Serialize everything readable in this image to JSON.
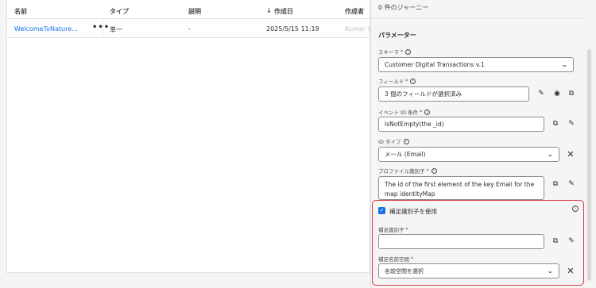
{
  "table": {
    "headers": {
      "name": "名前",
      "type": "タイプ",
      "description": "説明",
      "created": "作成日",
      "created_sort_icon": "arrow-down-icon",
      "creator": "作成者"
    },
    "rows": [
      {
        "name": "WelcomeToNature_1_...",
        "more": "•••",
        "type": "単一",
        "description": "-",
        "created": "2025/5/15 11:19",
        "creator": "Kumar Vi"
      }
    ]
  },
  "panel": {
    "journey_count": "0 件のジャーニー",
    "section_title": "パラメーター",
    "schema": {
      "label": "スキーマ",
      "required": "*",
      "value": "Customer Digital Transactions v.1"
    },
    "fields": {
      "label": "フィールド",
      "required": "*",
      "value": "3 個のフィールドが選択済み"
    },
    "event_id": {
      "label": "イベント ID 条件",
      "required": "*",
      "value": "IsNotEmpty(the _id)"
    },
    "id_type": {
      "label": "ID タイプ",
      "value": "メール (Email)"
    },
    "profile_id": {
      "label": "プロファイル識別子",
      "required": "*",
      "value": "The id of the first element of the key Email for the map identityMap"
    },
    "supplemental": {
      "checkbox_label": "補足識別子を使用",
      "checked": true,
      "id_label": "補足識別子",
      "id_required": "*",
      "id_value": "",
      "namespace_label": "補足名前空間",
      "namespace_required": "*",
      "namespace_value": "名前空間を選択"
    }
  },
  "colors": {
    "accent": "#1473e6",
    "highlight_border": "#d7373f"
  }
}
